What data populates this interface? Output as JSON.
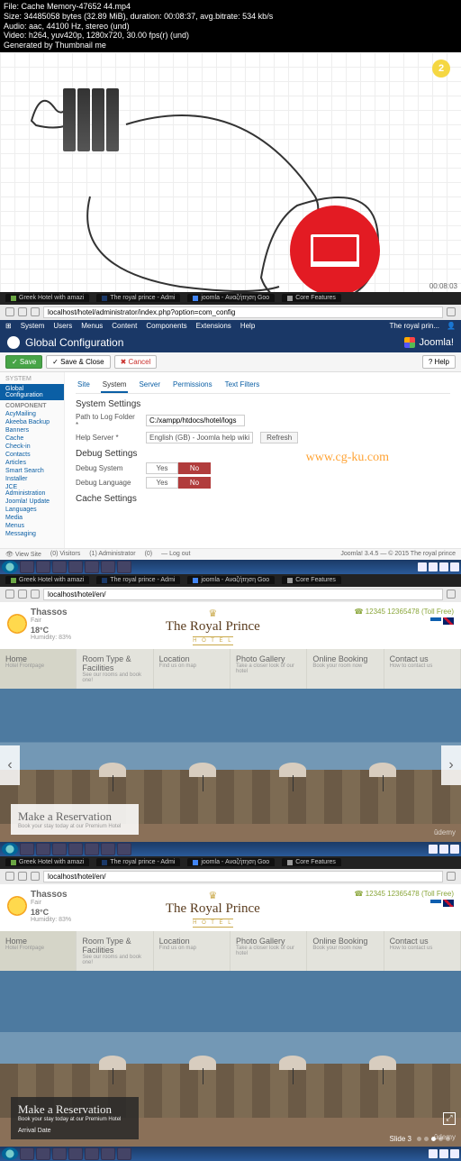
{
  "video_info": {
    "file": "File: Cache Memory-47652 44.mp4",
    "size": "Size: 34485058 bytes (32.89 MiB), duration: 00:08:37, avg.bitrate: 534 kb/s",
    "audio": "Audio: aac, 44100 Hz, stereo (und)",
    "video": "Video: h264, yuv420p, 1280x720, 30.00 fps(r) (und)",
    "gen": "Generated by Thumbnail me"
  },
  "diagram": {
    "badge": "2",
    "timecode": "00:08:03"
  },
  "browser_tabs": [
    {
      "label": "Greek Hotel with amazi"
    },
    {
      "label": "The royal prince - Admi"
    },
    {
      "label": "joomla - Αναζήτηση Goo"
    },
    {
      "label": "Core Features"
    }
  ],
  "address_bar": {
    "url": "localhost/hotel/administrator/index.php?option=com_config"
  },
  "joomla": {
    "top_menu": [
      "System",
      "Users",
      "Menus",
      "Content",
      "Components",
      "Extensions",
      "Help"
    ],
    "top_right": "The royal prin...",
    "header": "Global Configuration",
    "brand": "Joomla!",
    "toolbar": {
      "save": "✓ Save",
      "saveclose": "✓ Save & Close",
      "cancel": "✖ Cancel",
      "help": "? Help"
    },
    "sidebar": {
      "sys_label": "SYSTEM",
      "active": "Global Configuration",
      "group": "COMPONENT",
      "items": [
        "AcyMailing",
        "Akeeba Backup",
        "Banners",
        "Cache",
        "Check-in",
        "Contacts",
        "Articles",
        "Smart Search",
        "Installer",
        "JCE Administration",
        "Joomla! Update",
        "Languages",
        "Media",
        "Menus",
        "Messaging"
      ]
    },
    "tabs": [
      "Site",
      "System",
      "Server",
      "Permissions",
      "Text Filters"
    ],
    "sections": {
      "system": "System Settings",
      "debug": "Debug Settings",
      "cache": "Cache Settings"
    },
    "rows": {
      "log_label": "Path to Log Folder *",
      "log_value": "C:/xampp/htdocs/hotel/logs",
      "help_label": "Help Server *",
      "help_value": "English (GB) - Joomla help wiki",
      "refresh": "Refresh",
      "dbg_sys": "Debug System",
      "dbg_lang": "Debug Language",
      "yes": "Yes",
      "no": "No"
    },
    "status": {
      "left": [
        "👁 View Site",
        "(0) Visitors",
        "(1) Administrator",
        "(0)",
        "— Log out"
      ],
      "right": "Joomla! 3.4.5 — © 2015 The royal prince"
    }
  },
  "watermark": "www.cg-ku.com",
  "hotel": {
    "addr": "localhost/hotel/en/",
    "weather": {
      "city": "Thassos",
      "cond": "Fair",
      "temp": "18°C",
      "hum": "Humidity: 83%"
    },
    "brand": {
      "name": "The Royal Prince",
      "sub": "H O T E L"
    },
    "phone": "☎ 12345 12365478 (Toll Free)",
    "nav": [
      {
        "t1": "Home",
        "t2": "Hotel Frontpage"
      },
      {
        "t1": "Room Type & Facilities",
        "t2": "See our rooms and book one!"
      },
      {
        "t1": "Location",
        "t2": "Find us on map"
      },
      {
        "t1": "Photo Gallery",
        "t2": "Take a closer look of our hotel"
      },
      {
        "t1": "Online Booking",
        "t2": "Book your room now"
      },
      {
        "t1": "Contact us",
        "t2": "How to contact us"
      }
    ],
    "reserve": {
      "t1": "Make a Reservation",
      "t2": "Book your stay today at our Premium Hotel",
      "arrival": "Arrival Date"
    },
    "slide": "Slide 3"
  }
}
